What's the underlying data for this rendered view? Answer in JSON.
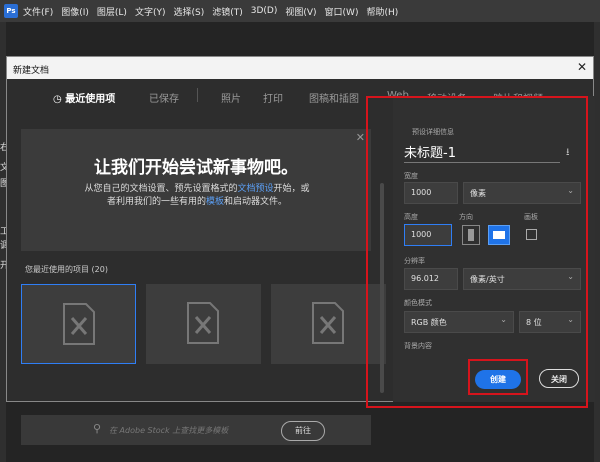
{
  "menubar": {
    "logo": "Ps",
    "items": [
      "文件(F)",
      "图像(I)",
      "图层(L)",
      "文字(Y)",
      "选择(S)",
      "滤镜(T)",
      "3D(D)",
      "视图(V)",
      "窗口(W)",
      "帮助(H)"
    ]
  },
  "dialog": {
    "title": "新建文档",
    "tabs": [
      "最近使用项",
      "已保存",
      "照片",
      "打印",
      "图稿和插图",
      "Web",
      "移动设备",
      "胶片和视频"
    ],
    "hero_title": "让我们开始尝试新事物吧。",
    "hero_text_1": "从您自己的文档设置、预先设置格式的",
    "hero_link_1": "文档预设",
    "hero_text_2": "开始，或者利用我们的一些有用的",
    "hero_link_2": "模板",
    "hero_text_3": "和启动器文件。",
    "recent_label": "您最近使用的项目",
    "recent_count": "(20)",
    "search_placeholder": "在 Adobe Stock 上查找更多模板",
    "search_button": "前往"
  },
  "preset": {
    "section": "预设详细信息",
    "name": "未标题-1",
    "width_label": "宽度",
    "width_value": "1000",
    "width_unit": "像素",
    "height_label": "高度",
    "height_value": "1000",
    "orientation_label": "方向",
    "artboard_label": "画板",
    "resolution_label": "分辨率",
    "resolution_value": "96.012",
    "resolution_unit": "像素/英寸",
    "color_mode_label": "颜色模式",
    "color_mode_value": "RGB 颜色",
    "bit_depth": "8 位",
    "background_label": "背景内容",
    "create_button": "创建",
    "close_button": "关闭"
  },
  "side_panels": [
    "右",
    "文",
    "图",
    "工",
    "调",
    "开"
  ]
}
